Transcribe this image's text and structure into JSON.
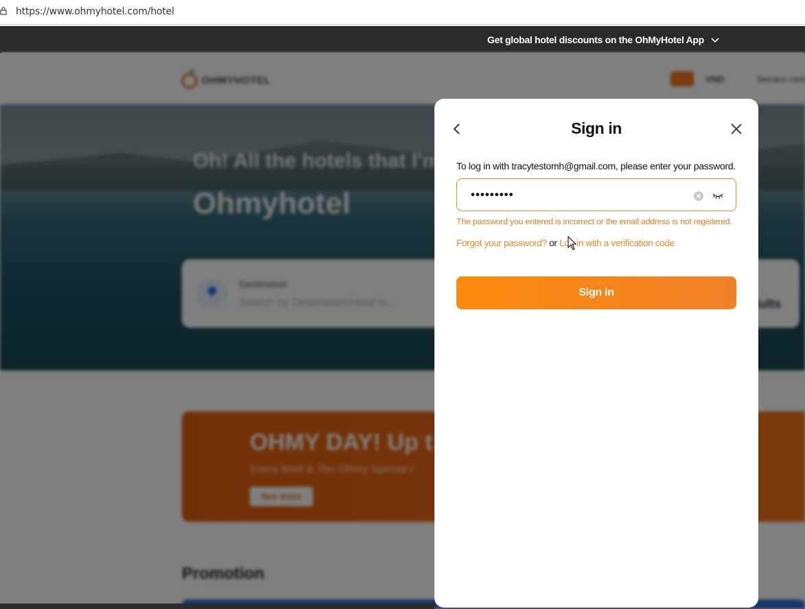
{
  "browser": {
    "url": "https://www.ohmyhotel.com/hotel"
  },
  "topbar": {
    "promo_text": "Get global hotel discounts on the OhMyHotel App"
  },
  "background": {
    "logo_text": "OHMYHOTEL",
    "currency": "VND",
    "service_center": "Service cent",
    "hero_tagline": "Oh! All the hotels that I'm",
    "hero_brand": "Ohmyhotel",
    "search": {
      "destination_label": "Destination",
      "destination_placeholder": "Search by Destination/Hotel N...",
      "guests_label": "s",
      "guests_value": "dults"
    },
    "ohmyday": {
      "headline": "OHMY DAY! Up t",
      "subline": "Every Wed & Thu Ohmy Special I",
      "button": "See more"
    },
    "promotion_title": "Promotion"
  },
  "modal": {
    "title": "Sign in",
    "instruction": "To log in with tracytestomh@gmail.com, please enter your password.",
    "password_mask": "•••••••••",
    "error": "The password you entered is incorrect or the email address is not registered.",
    "forgot_link": "Forgot your password?",
    "or_text": "or",
    "verification_link": "Log in with a verification code",
    "sign_in_button": "Sign in"
  },
  "colors": {
    "accent": "#f0801f",
    "error": "#e07b20",
    "topbar_bg": "#2a2a2a"
  }
}
